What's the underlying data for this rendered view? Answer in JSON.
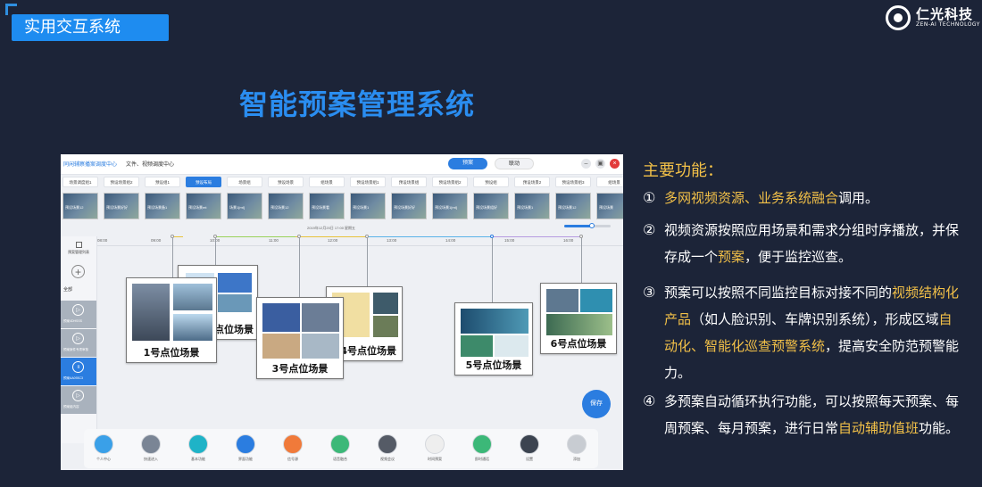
{
  "header": {
    "tag": "实用交互系统",
    "logo_cn": "仁光科技",
    "logo_en": "ZEN-AI TECHNOLOGY"
  },
  "main_title": "智能预案管理系统",
  "screenshot": {
    "app_title": "同闲辅察播案调度中心",
    "app_menu": "文件、视频调度中心",
    "seg_tabs": [
      "预案",
      "联动"
    ],
    "window_buttons": [
      "minimize-icon",
      "restore-icon",
      "close-icon"
    ],
    "tabs": [
      {
        "label": "场景调度组1",
        "active": false
      },
      {
        "label": "预设场景组2",
        "active": false
      },
      {
        "label": "预设组1",
        "active": false
      },
      {
        "label": "预设布局",
        "active": true
      },
      {
        "label": "场景组",
        "active": false
      },
      {
        "label": "预设场景",
        "active": false
      },
      {
        "label": "组场景",
        "active": false
      },
      {
        "label": "预设场景组1",
        "active": false
      },
      {
        "label": "预设场景组",
        "active": false
      },
      {
        "label": "预设场景组2",
        "active": false
      },
      {
        "label": "预设组",
        "active": false
      },
      {
        "label": "预设场景2",
        "active": false
      },
      {
        "label": "预设场景组3",
        "active": false
      },
      {
        "label": "组场景",
        "active": false
      }
    ],
    "thumbs": [
      "预设场景12",
      "预设场景好好",
      "预设场景备1",
      "预设场景mt",
      "场景1[mt]",
      "预设场景12",
      "预设场景看",
      "预设场景1",
      "预设场景好好",
      "预设场景1[mt]",
      "预设场景组好",
      "预设场景1",
      "预设场景12",
      "预设场景",
      "预设场景12"
    ],
    "date_text": "2019年12月20日    17:00    星期五",
    "slider_value": 0.6,
    "sidebar": {
      "head": "预案管理列表",
      "all": "全部",
      "items": [
        {
          "label": "预案4DHSSS",
          "active": false
        },
        {
          "label": "预案案件专项审核",
          "active": false
        },
        {
          "label": "预案AA093C3",
          "active": true
        },
        {
          "label": "预案组内容",
          "active": false
        }
      ]
    },
    "ruler_ticks": [
      "08:00",
      "09:00",
      "10:00",
      "11:00",
      "12:00",
      "13:00",
      "14:00",
      "15:00",
      "16:00"
    ],
    "cards": [
      {
        "caption": "1号点位场景"
      },
      {
        "caption": "2号点位场景"
      },
      {
        "caption": "3号点位场景"
      },
      {
        "caption": "4号点位场景"
      },
      {
        "caption": "5号点位场景"
      },
      {
        "caption": "6号点位场景"
      }
    ],
    "save_button": "保存",
    "dock": [
      {
        "label": "个人中心",
        "icon": "user-icon",
        "color": "#3aa0e8"
      },
      {
        "label": "快速进入",
        "icon": "compass-icon",
        "color": "#7a8595"
      },
      {
        "label": "基本功能",
        "icon": "app-icon",
        "color": "#1fb3c7"
      },
      {
        "label": "界面功能",
        "icon": "layout-icon",
        "color": "#2b7de0"
      },
      {
        "label": "信号源",
        "icon": "signal-icon",
        "color": "#f07a3a"
      },
      {
        "label": "语音融合",
        "icon": "mic-icon",
        "color": "#3cb878"
      },
      {
        "label": "视频会议",
        "icon": "conference-icon",
        "color": "#555b66"
      },
      {
        "label": "时间预案",
        "icon": "clock-icon",
        "color": "#eeeeee"
      },
      {
        "label": "即时通话",
        "icon": "call-icon",
        "color": "#3cb878"
      },
      {
        "label": "设置",
        "icon": "gear-icon",
        "color": "#3c4450"
      },
      {
        "label": "添加",
        "icon": "add-icon",
        "color": "#c8ccd2"
      }
    ]
  },
  "features": {
    "title": "主要功能：",
    "items": [
      {
        "num": "①",
        "parts": [
          {
            "t": "多网视频资源、业务系统融合",
            "hl": true
          },
          {
            "t": "调用。",
            "hl": false
          }
        ]
      },
      {
        "num": "②",
        "parts": [
          {
            "t": "视频资源按照应用场景和需求分组时序播放，并保存成一个",
            "hl": false
          },
          {
            "t": "预案",
            "hl": true
          },
          {
            "t": "，便于监控巡查。",
            "hl": false
          }
        ]
      },
      {
        "num": "③",
        "parts": [
          {
            "t": "预案可以按照不同监控目标对接不同的",
            "hl": false
          },
          {
            "t": "视频结构化产品",
            "hl": true
          },
          {
            "t": "（如人脸识别、车牌识别系统），形成区域",
            "hl": false
          },
          {
            "t": "自动化、智能化巡查预警系统",
            "hl": true
          },
          {
            "t": "，提高安全防范预警能力。",
            "hl": false
          }
        ]
      },
      {
        "num": "④",
        "parts": [
          {
            "t": "多预案自动循环执行功能，可以按照每天预案、每周预案、每月预案，进行日常",
            "hl": false
          },
          {
            "t": "自动辅助值班",
            "hl": true
          },
          {
            "t": "功能。",
            "hl": false
          }
        ]
      }
    ]
  }
}
